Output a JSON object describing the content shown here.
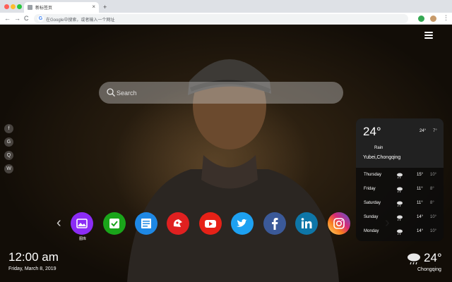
{
  "browser": {
    "tab_title": "新标签页",
    "tab_close": "×",
    "new_tab": "+",
    "back": "←",
    "forward": "→",
    "reload": "C",
    "omnibox_placeholder": "在Google中搜索，或者输入一个网址",
    "google_letter": "G",
    "menu": "⋮"
  },
  "search": {
    "placeholder": "Search"
  },
  "social_links": [
    {
      "icon": "facebook-icon",
      "glyph": "f"
    },
    {
      "icon": "google-plus-icon",
      "glyph": "G"
    },
    {
      "icon": "qq-icon",
      "glyph": "Q"
    },
    {
      "icon": "wechat-icon",
      "glyph": "W"
    }
  ],
  "apps": {
    "prev": "‹",
    "next": "›",
    "items": [
      {
        "icon": "gallery-icon",
        "color": "#8b2cf5",
        "label": "图库"
      },
      {
        "icon": "checklist-icon",
        "color": "#1aa51a"
      },
      {
        "icon": "notes-icon",
        "color": "#1e88e5"
      },
      {
        "icon": "game-icon",
        "color": "#e02020"
      },
      {
        "icon": "youtube-icon",
        "color": "#e62117"
      },
      {
        "icon": "twitter-icon",
        "color": "#1da1f2"
      },
      {
        "icon": "facebook-icon",
        "color": "#3b5998"
      },
      {
        "icon": "linkedin-icon",
        "color": "#0e76a8"
      },
      {
        "icon": "instagram-icon",
        "color": "#d6249f"
      }
    ]
  },
  "weather": {
    "temp": "24°",
    "high": "24°",
    "low": "7°",
    "condition": "Rain",
    "location": "Yubei,Chongqing",
    "forecast": [
      {
        "day": "Thursday",
        "high": "15°",
        "low": "10°"
      },
      {
        "day": "Friday",
        "high": "11°",
        "low": "8°"
      },
      {
        "day": "Saturday",
        "high": "11°",
        "low": "8°"
      },
      {
        "day": "Sunday",
        "high": "14°",
        "low": "10°"
      },
      {
        "day": "Monday",
        "high": "14°",
        "low": "10°"
      }
    ]
  },
  "clock": {
    "time": "12:00 am",
    "date": "Friday, March 8, 2019"
  },
  "current": {
    "temp": "24°",
    "city": "Chongqing"
  }
}
